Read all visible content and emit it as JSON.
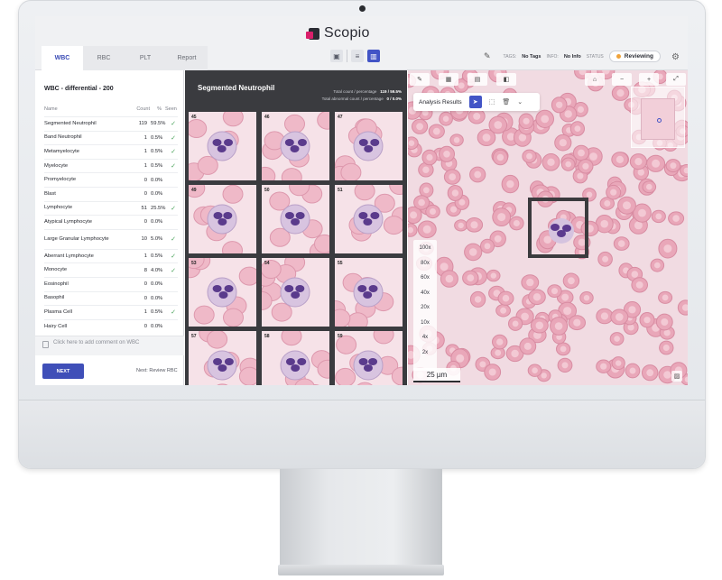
{
  "brand": {
    "name": "Scopio"
  },
  "tabs": [
    {
      "label": "WBC",
      "active": true
    },
    {
      "label": "RBC",
      "active": false
    },
    {
      "label": "PLT",
      "active": false
    },
    {
      "label": "Report",
      "active": false
    }
  ],
  "header": {
    "tags_label": "TAGS:",
    "tags_value": "No Tags",
    "info_label": "INFO:",
    "info_value": "No Info",
    "status_label": "STATUS",
    "status_value": "Reviewing",
    "status_color": "#f0a33a"
  },
  "wbc_panel": {
    "title": "WBC - differential - 200",
    "columns": {
      "name": "Name",
      "count": "Count",
      "pct": "%",
      "seen": "Seen"
    },
    "rows": [
      {
        "name": "Segmented Neutrophil",
        "count": "119",
        "pct": "59.5%",
        "seen": true
      },
      {
        "name": "Band Neutrophil",
        "count": "1",
        "pct": "0.5%",
        "seen": true
      },
      {
        "name": "Metamyelocyte",
        "count": "1",
        "pct": "0.5%",
        "seen": true
      },
      {
        "name": "Myelocyte",
        "count": "1",
        "pct": "0.5%",
        "seen": true
      },
      {
        "name": "Promyelocyte",
        "count": "0",
        "pct": "0.0%",
        "seen": false
      },
      {
        "name": "Blast",
        "count": "0",
        "pct": "0.0%",
        "seen": false
      },
      {
        "name": "Lymphocyte",
        "count": "51",
        "pct": "25.5%",
        "seen": true
      },
      {
        "name": "Atypical Lymphocyte",
        "count": "0",
        "pct": "0.0%",
        "seen": false
      },
      {
        "name": "Large Granular Lymphocyte",
        "count": "10",
        "pct": "5.0%",
        "seen": true
      },
      {
        "name": "Aberrant Lymphocyte",
        "count": "1",
        "pct": "0.5%",
        "seen": true
      },
      {
        "name": "Monocyte",
        "count": "8",
        "pct": "4.0%",
        "seen": true
      },
      {
        "name": "Eosinophil",
        "count": "0",
        "pct": "0.0%",
        "seen": false
      },
      {
        "name": "Basophil",
        "count": "0",
        "pct": "0.0%",
        "seen": false
      },
      {
        "name": "Plasma Cell",
        "count": "1",
        "pct": "0.5%",
        "seen": true
      },
      {
        "name": "Hairy Cell",
        "count": "0",
        "pct": "0.0%",
        "seen": false
      }
    ],
    "comment_placeholder": "Click here to add comment on WBC",
    "next_label": "NEXT",
    "next_hint": "Next: Review RBC"
  },
  "gallery": {
    "title": "Segmented Neutrophil",
    "total_count_label": "Total count / percentage",
    "total_count_value": "119 / 59.5%",
    "abnormal_label": "Total abnormal count / percentage",
    "abnormal_value": "0 / 0.0%",
    "cells": [
      "45",
      "46",
      "47",
      "49",
      "50",
      "51",
      "53",
      "54",
      "55",
      "57",
      "58",
      "59"
    ]
  },
  "viewer": {
    "analysis_label": "Analysis Results",
    "zoom_levels": [
      "100x",
      "80x",
      "60x",
      "40x",
      "20x",
      "10x",
      "4x",
      "2x"
    ],
    "scale_label": "25 µm",
    "accent_color": "#4254c6"
  }
}
